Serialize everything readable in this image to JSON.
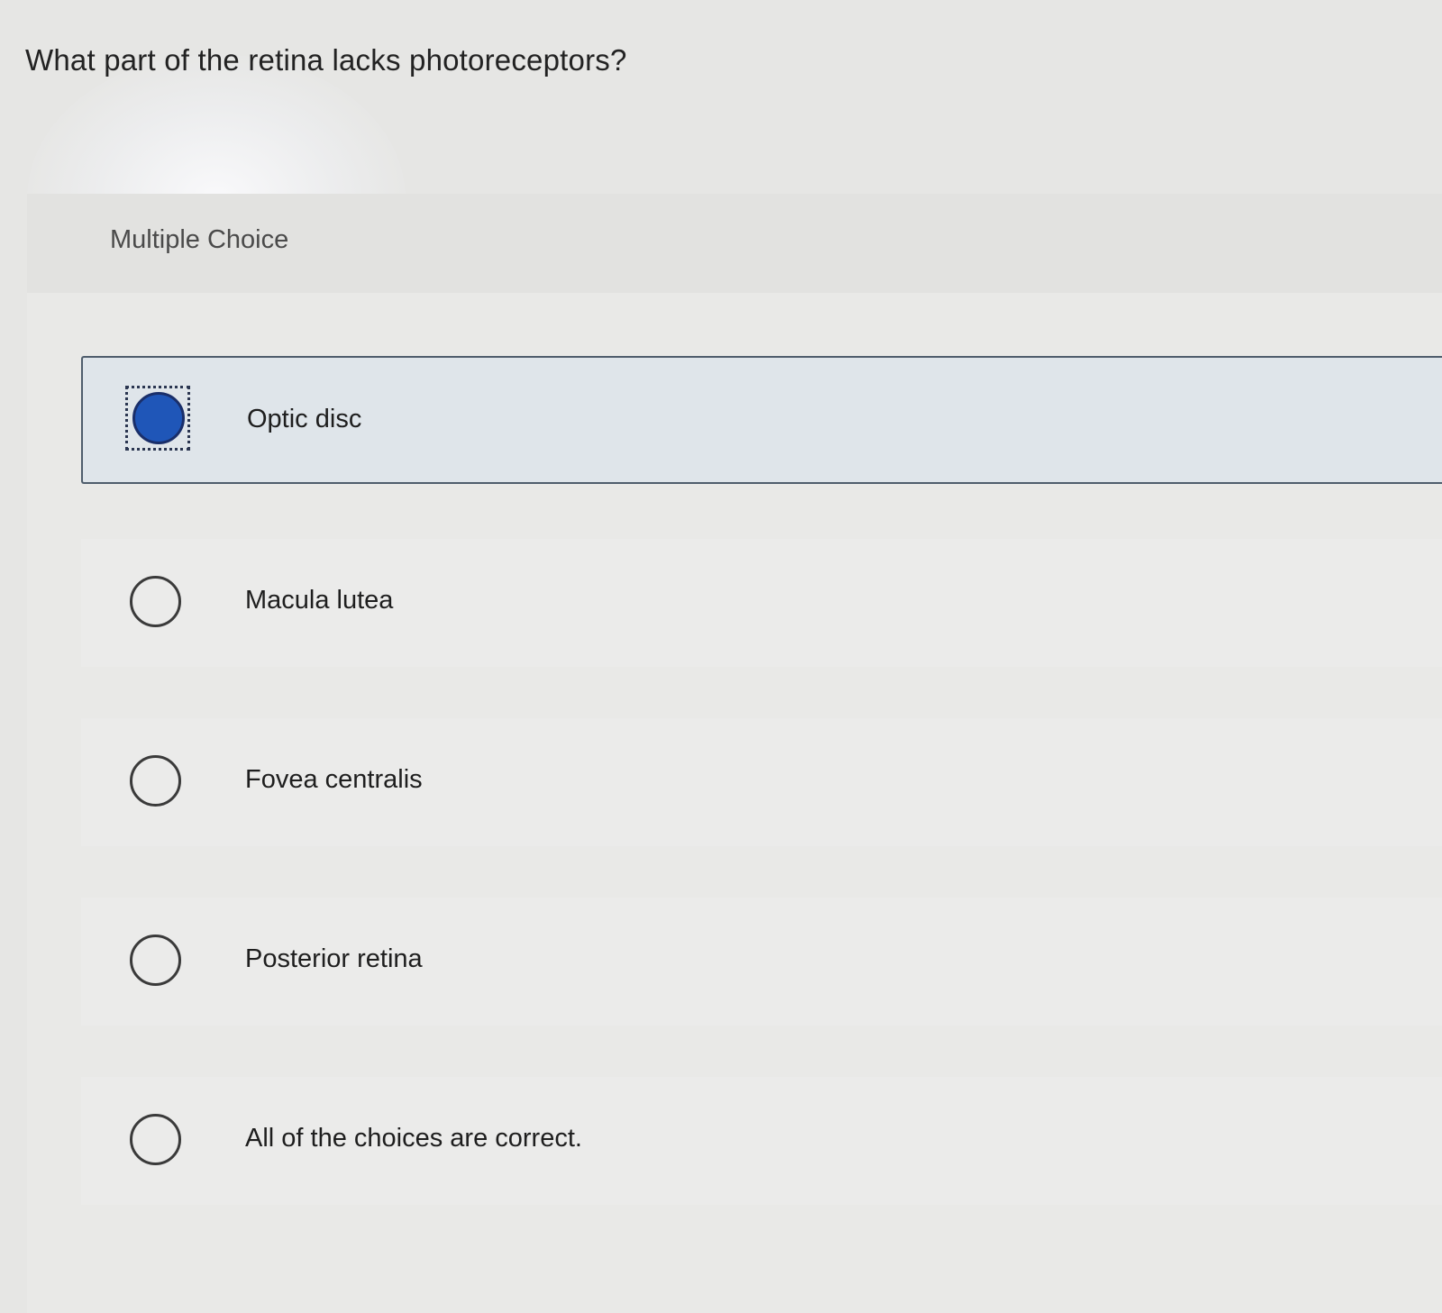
{
  "question": {
    "text": "What part of the retina lacks photoreceptors?"
  },
  "panel": {
    "type_label": "Multiple Choice"
  },
  "options": [
    {
      "label": "Optic disc",
      "selected": true
    },
    {
      "label": "Macula lutea",
      "selected": false
    },
    {
      "label": "Fovea centralis",
      "selected": false
    },
    {
      "label": "Posterior retina",
      "selected": false
    },
    {
      "label": "All of the choices are correct.",
      "selected": false
    }
  ],
  "colors": {
    "selected_radio": "#1f56b8",
    "selected_row_bg": "#dfe5ea",
    "selected_row_border": "#4f5d6c"
  }
}
